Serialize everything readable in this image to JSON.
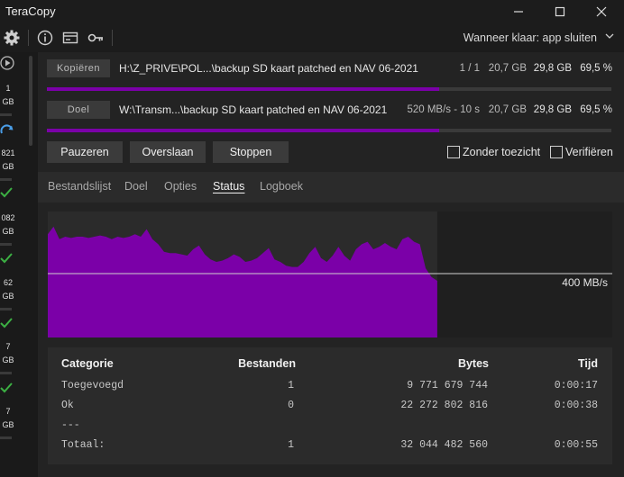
{
  "app": {
    "title": "TeraCopy"
  },
  "toolbar": {
    "when_done": "Wanneer klaar: app sluiten"
  },
  "queue": [
    {
      "count": "1",
      "size": "GB"
    },
    {
      "count": "821",
      "size": "GB"
    },
    {
      "count": "082",
      "size": "GB"
    },
    {
      "count": "62",
      "size": "GB"
    },
    {
      "count": "7",
      "size": "GB"
    },
    {
      "count": "7",
      "size": "GB"
    }
  ],
  "source": {
    "label": "Kopiëren",
    "path": "H:\\Z_PRIVE\\POL...\\backup SD kaart patched en NAV 06-2021",
    "files": "1 / 1",
    "done": "20,7 GB",
    "total": "29,8 GB",
    "percent": "69,5 %",
    "progress": 0.695
  },
  "target": {
    "label": "Doel",
    "path": "W:\\Transm...\\backup SD kaart patched en NAV 06-2021",
    "speed": "520 MB/s - 10 s",
    "done": "20,7 GB",
    "total": "29,8 GB",
    "percent": "69,5 %",
    "progress": 0.695
  },
  "actions": {
    "pause": "Pauzeren",
    "skip": "Overslaan",
    "stop": "Stoppen"
  },
  "options": {
    "unattended": "Zonder toezicht",
    "verify": "Verifiëren"
  },
  "tabs": [
    "Bestandslijst",
    "Doel",
    "Opties",
    "Status",
    "Logboek"
  ],
  "active_tab": "Status",
  "chart_data": {
    "type": "area",
    "speed_label": "400 MB/s",
    "color": "#7b00a8",
    "x_fraction_filled": 0.69,
    "values": [
      0.82,
      0.88,
      0.78,
      0.8,
      0.79,
      0.8,
      0.8,
      0.79,
      0.8,
      0.81,
      0.8,
      0.78,
      0.8,
      0.79,
      0.8,
      0.82,
      0.8,
      0.86,
      0.78,
      0.74,
      0.68,
      0.67,
      0.67,
      0.66,
      0.65,
      0.7,
      0.73,
      0.66,
      0.62,
      0.6,
      0.61,
      0.63,
      0.66,
      0.64,
      0.6,
      0.61,
      0.63,
      0.67,
      0.71,
      0.62,
      0.6,
      0.57,
      0.56,
      0.56,
      0.6,
      0.67,
      0.72,
      0.63,
      0.6,
      0.65,
      0.72,
      0.65,
      0.61,
      0.7,
      0.74,
      0.76,
      0.7,
      0.72,
      0.75,
      0.72,
      0.7,
      0.78,
      0.8,
      0.76,
      0.74,
      0.55,
      0.48,
      0.45
    ]
  },
  "stats": {
    "headers": {
      "category": "Categorie",
      "files": "Bestanden",
      "bytes": "Bytes",
      "time": "Tijd"
    },
    "rows": [
      {
        "category": "Toegevoegd",
        "files": "1",
        "bytes": "9 771 679 744",
        "time": "0:00:17"
      },
      {
        "category": "Ok",
        "files": "0",
        "bytes": "22 272 802 816",
        "time": "0:00:38"
      },
      {
        "category": "---",
        "files": "",
        "bytes": "",
        "time": ""
      },
      {
        "category": "Totaal:",
        "files": "1",
        "bytes": "32 044 482 560",
        "time": "0:00:55"
      }
    ]
  }
}
